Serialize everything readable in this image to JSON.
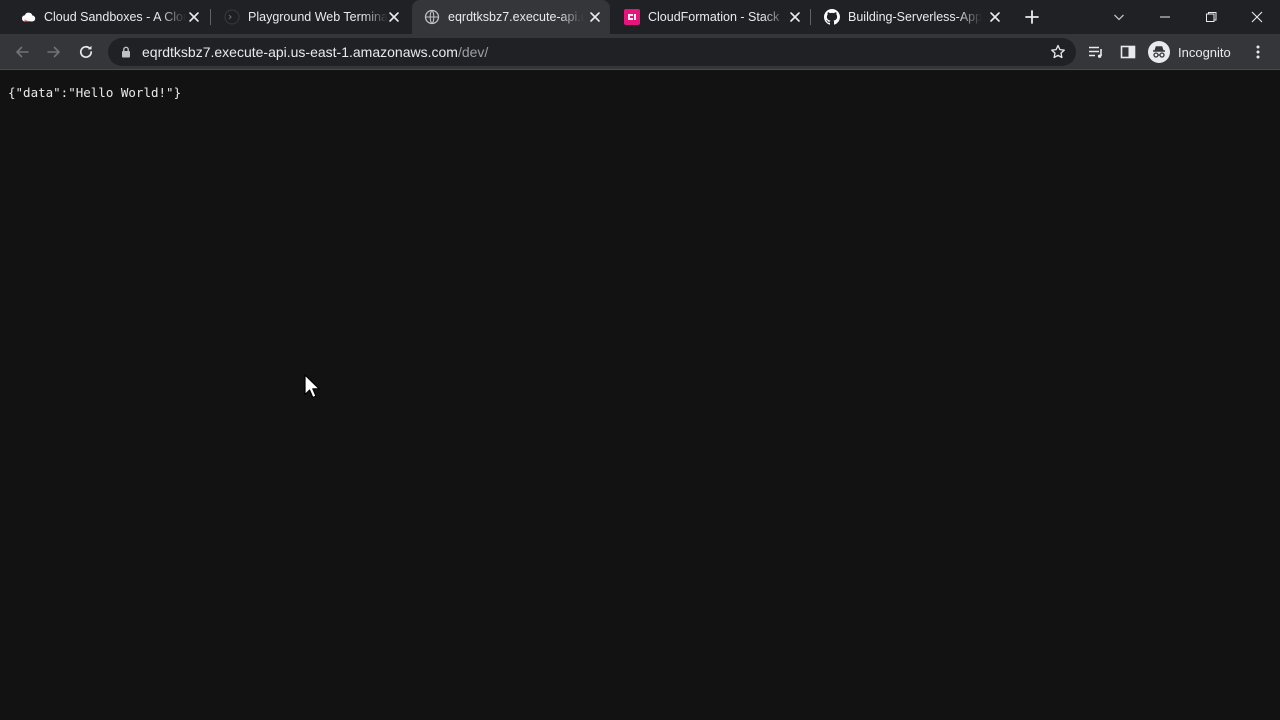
{
  "tabs": [
    {
      "title": "Cloud Sandboxes - A Cloud Guru",
      "icon": "cloud-icon",
      "active": false
    },
    {
      "title": "Playground Web Terminal",
      "icon": "terminal-icon",
      "active": false
    },
    {
      "title": "eqrdtksbz7.execute-api.us-east-1.amazonaws.com",
      "icon": "globe-icon",
      "active": true
    },
    {
      "title": "CloudFormation - Stack",
      "icon": "cloudformation-icon",
      "active": false
    },
    {
      "title": "Building-Serverless-Apps",
      "icon": "github-icon",
      "active": false
    }
  ],
  "address_bar": {
    "host": "eqrdtksbz7.execute-api.us-east-1.amazonaws.com",
    "path": "/dev/"
  },
  "profile": {
    "label": "Incognito"
  },
  "page": {
    "body_text": "{\"data\":\"Hello World!\"}"
  },
  "colors": {
    "tabstrip_bg": "#202124",
    "toolbar_bg": "#35363a",
    "omnibox_bg": "#202124",
    "page_bg": "#121212",
    "text": "#e8eaed",
    "muted_text": "#9aa0a6",
    "cloudformation_brand": "#e7157b"
  }
}
